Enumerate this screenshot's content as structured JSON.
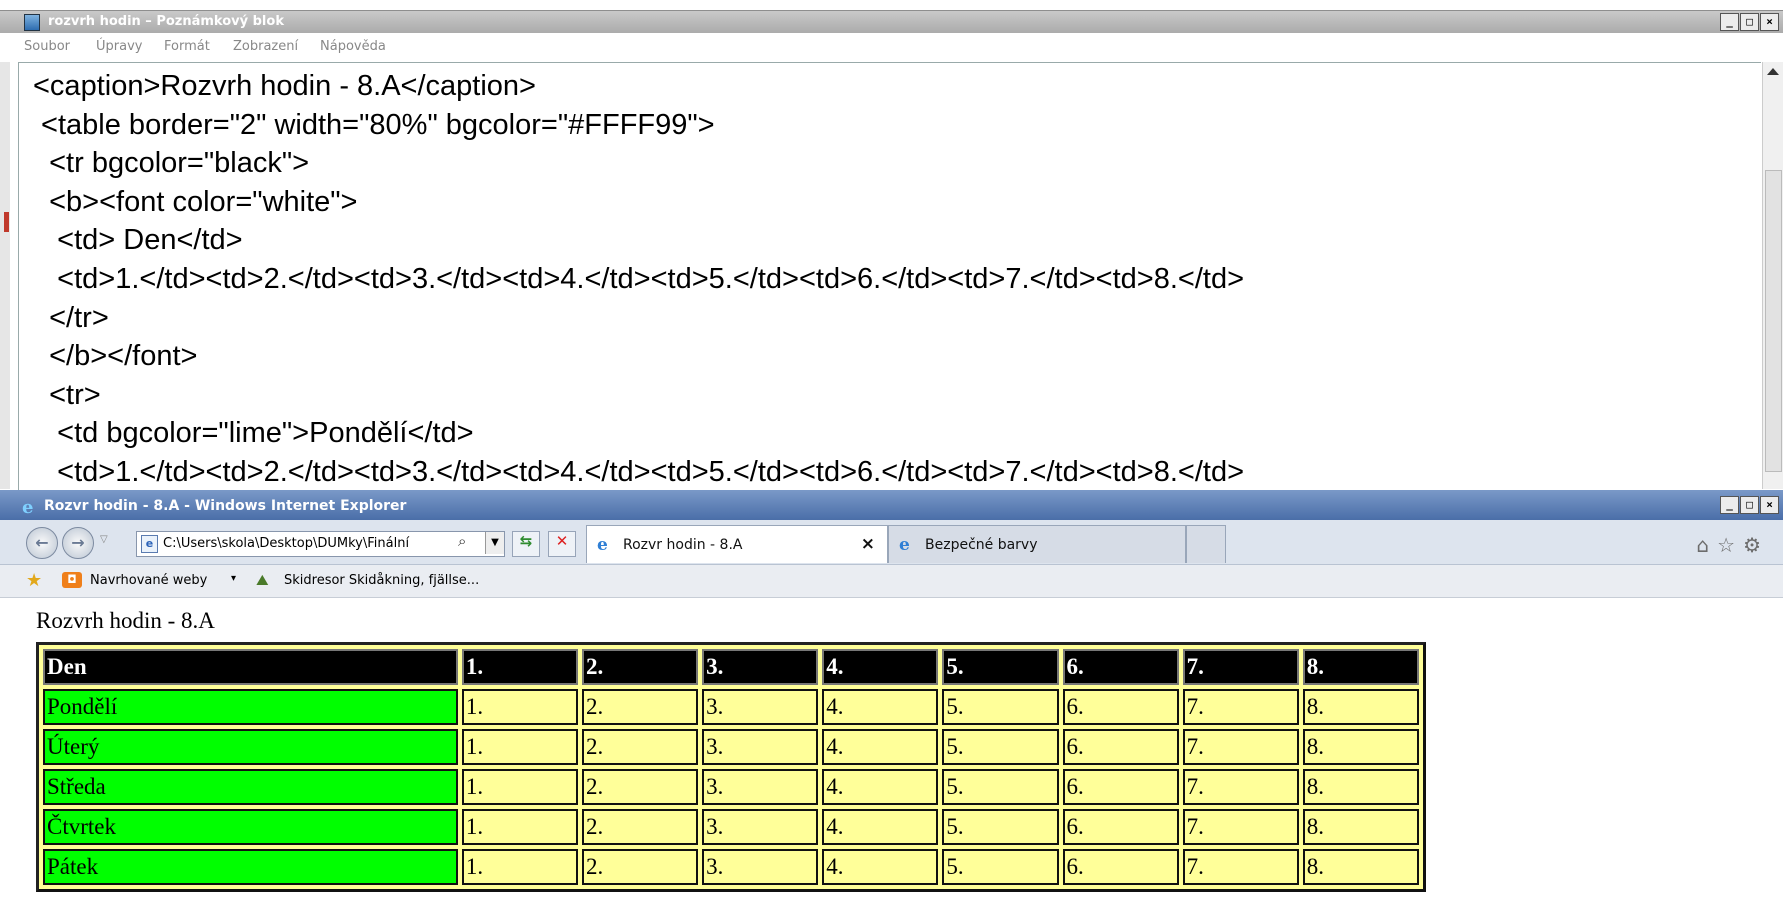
{
  "notepad": {
    "title": "rozvrh hodin – Poznámkový blok",
    "menu": [
      "Soubor",
      "Úpravy",
      "Formát",
      "Zobrazení",
      "Nápověda"
    ],
    "caption_buttons": [
      "_",
      "□",
      "×"
    ],
    "code_lines": [
      "<caption>Rozvrh hodin - 8.A</caption>",
      " <table border=\"2\" width=\"80%\" bgcolor=\"#FFFF99\">",
      "  <tr bgcolor=\"black\">",
      "  <b><font color=\"white\">",
      "   <td> Den</td>",
      "   <td>1.</td><td>2.</td><td>3.</td><td>4.</td><td>5.</td><td>6.</td><td>7.</td><td>8.</td>",
      "  </tr>",
      "  </b></font>",
      "  <tr>",
      "   <td bgcolor=\"lime\">Pondělí</td>",
      "   <td>1.</td><td>2.</td><td>3.</td><td>4.</td><td>5.</td><td>6.</td><td>7.</td><td>8.</td>"
    ]
  },
  "ie": {
    "title": "Rozvr hodin - 8.A - Windows Internet Explorer",
    "caption_buttons": [
      "_",
      "□",
      "×"
    ],
    "address": "C:\\Users\\skola\\Desktop\\DUMky\\Finální",
    "tabs": [
      {
        "label": "Rozvr hodin - 8.A",
        "active": true,
        "close": "×"
      },
      {
        "label": "Bezpečné barvy",
        "active": false
      }
    ],
    "favorites": {
      "suggested": "Navrhované weby",
      "ski": "Skidresor Skidåkning, fjällse..."
    },
    "toolbar_icons": [
      "home-icon",
      "star-icon",
      "gear-icon"
    ],
    "page": {
      "caption": "Rozvrh hodin - 8.A",
      "header": [
        "Den",
        "1.",
        "2.",
        "3.",
        "4.",
        "5.",
        "6.",
        "7.",
        "8."
      ],
      "rows": [
        [
          "Pondělí",
          "1.",
          "2.",
          "3.",
          "4.",
          "5.",
          "6.",
          "7.",
          "8."
        ],
        [
          "Úterý",
          "1.",
          "2.",
          "3.",
          "4.",
          "5.",
          "6.",
          "7.",
          "8."
        ],
        [
          "Středa",
          "1.",
          "2.",
          "3.",
          "4.",
          "5.",
          "6.",
          "7.",
          "8."
        ],
        [
          "Čtvrtek",
          "1.",
          "2.",
          "3.",
          "4.",
          "5.",
          "6.",
          "7.",
          "8."
        ],
        [
          "Pátek",
          "1.",
          "2.",
          "3.",
          "4.",
          "5.",
          "6.",
          "7.",
          "8."
        ]
      ],
      "colors": {
        "table_bg": "#FFFF99",
        "header_bg": "#000000",
        "day_bg": "#00FF00"
      }
    }
  }
}
